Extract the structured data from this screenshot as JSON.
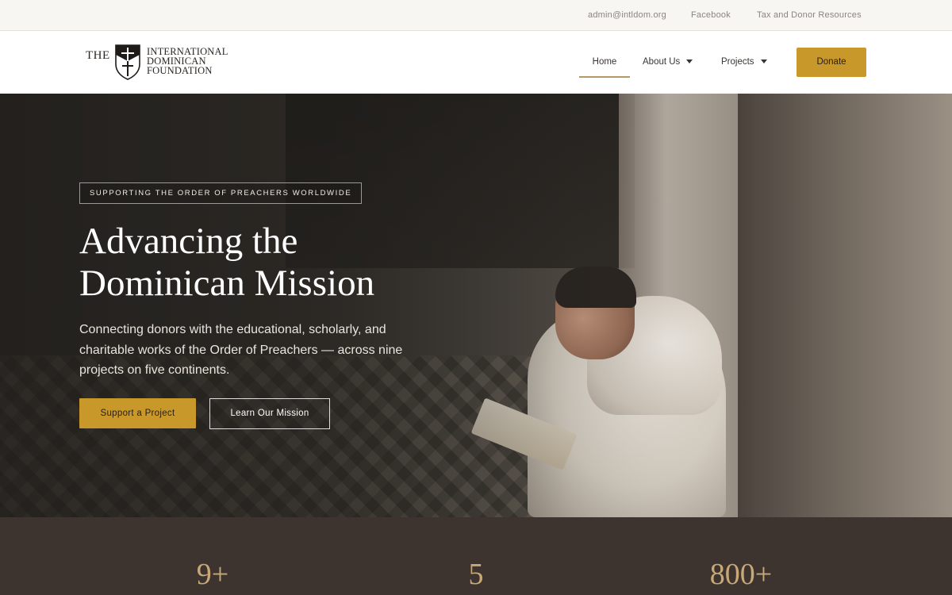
{
  "topbar": {
    "email": "admin@intldom.org",
    "facebook": "Facebook",
    "tax": "Tax and Donor Resources"
  },
  "logo": {
    "the": "THE",
    "line1": "INTERNATIONAL",
    "line2": "DOMINICAN",
    "line3": "FOUNDATION",
    "emblem": "dominican-cross-shield-icon"
  },
  "nav": {
    "items": [
      {
        "label": "Home",
        "active": true
      },
      {
        "label": "About Us",
        "has_dropdown": true
      },
      {
        "label": "Projects",
        "has_dropdown": true
      }
    ],
    "donate": "Donate"
  },
  "hero": {
    "eyebrow": "SUPPORTING THE ORDER OF PREACHERS WORLDWIDE",
    "headline_line1": "Advancing the",
    "headline_line2": "Dominican Mission",
    "subtext": "Connecting donors with the educational, scholarly, and charitable works of the Order of Preachers — across nine projects on five continents.",
    "primary_button": "Support a Project",
    "secondary_button": "Learn Our Mission"
  },
  "stats": [
    {
      "value": "9+"
    },
    {
      "value": "5"
    },
    {
      "value": "800+"
    }
  ],
  "colors": {
    "accent_gold": "#c8982a",
    "stat_gold": "#c9a877",
    "stats_band": "#3d3430",
    "nav_underline": "#b79768"
  }
}
